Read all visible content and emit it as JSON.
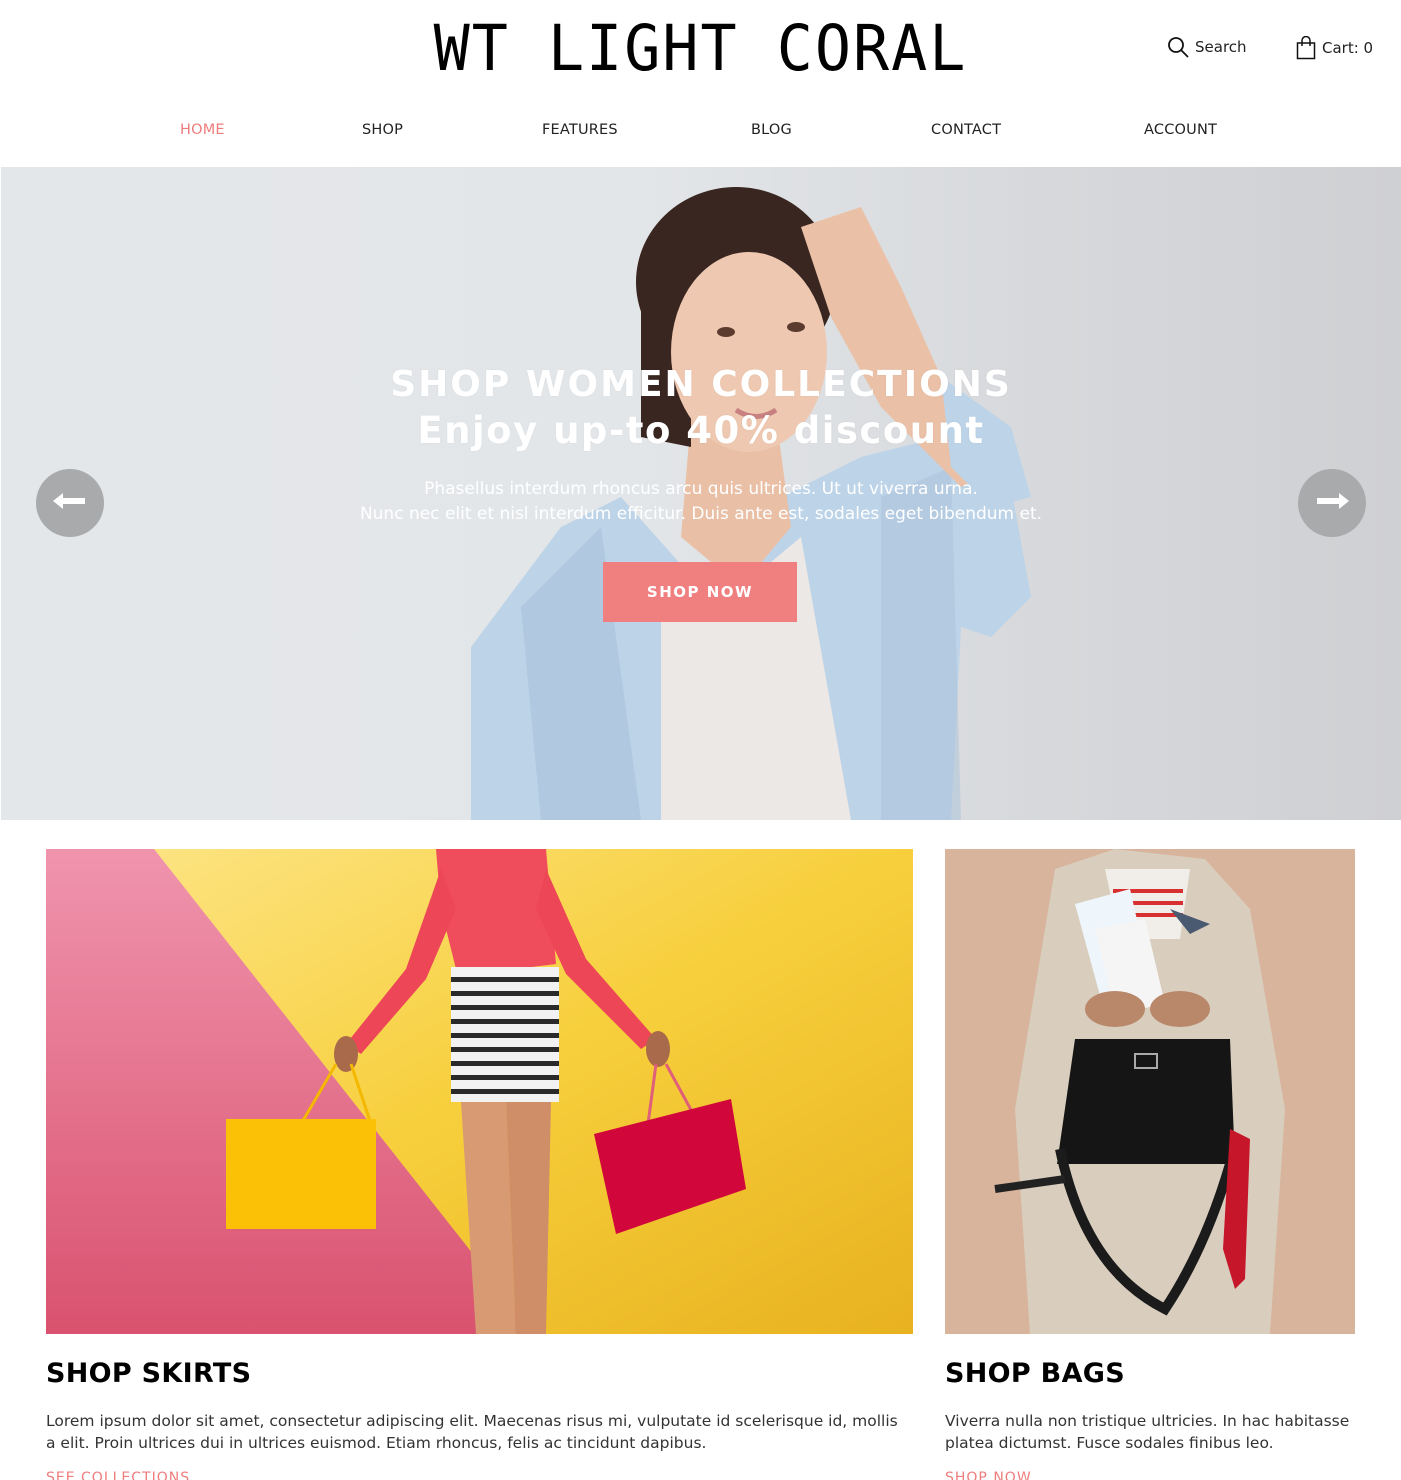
{
  "header": {
    "logo": "WT LIGHT CORAL",
    "search_label": "Search",
    "search_icon": "search-icon",
    "cart_label": "Cart: 0",
    "cart_icon": "shopping-bag-icon"
  },
  "nav": {
    "items": [
      {
        "label": "HOME",
        "active": true
      },
      {
        "label": "SHOP",
        "active": false
      },
      {
        "label": "FEATURES",
        "active": false
      },
      {
        "label": "BLOG",
        "active": false
      },
      {
        "label": "CONTACT",
        "active": false
      },
      {
        "label": "ACCOUNT",
        "active": false
      }
    ]
  },
  "hero": {
    "title_line1": "SHOP WOMEN COLLECTIONS",
    "title_line2": "Enjoy up-to 40% discount",
    "subtitle_line1": "Phasellus interdum rhoncus arcu quis ultrices. Ut ut viverra urna.",
    "subtitle_line2": "Nunc nec elit et nisl interdum efficitur. Duis ante est, sodales eget bibendum et.",
    "cta_label": "SHOP NOW",
    "prev_icon": "arrow-left-icon",
    "next_icon": "arrow-right-icon"
  },
  "cards": [
    {
      "title": "SHOP SKIRTS",
      "description_line1": "Lorem ipsum dolor sit amet, consectetur adipiscing elit. Maecenas risus mi, vulputate id scelerisque id, mollis",
      "description_line2": "a elit. Proin ultrices dui in ultrices euismod. Etiam rhoncus, felis ac tincidunt dapibus.",
      "link_label": "SEE COLLECTIONS"
    },
    {
      "title": "SHOP BAGS",
      "description_line1": "Viverra nulla non tristique ultricies. In hac habitasse",
      "description_line2": "platea dictumst. Fusce sodales finibus leo.",
      "link_label": "SHOP NOW"
    }
  ],
  "colors": {
    "accent": "#f08080",
    "nav_active": "#ef7c7c",
    "text": "#222222",
    "arrow_bg": "#a9aaab"
  }
}
